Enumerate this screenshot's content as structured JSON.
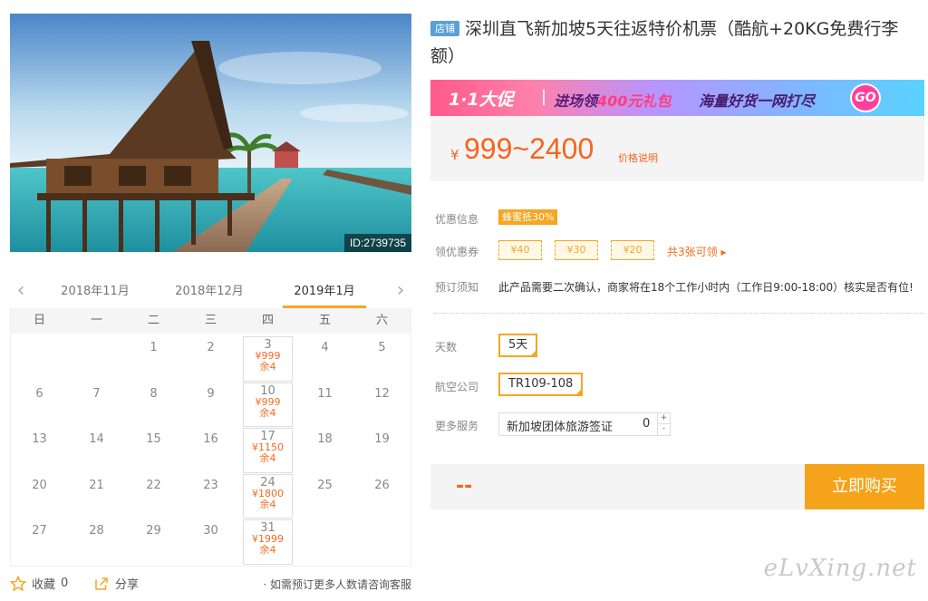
{
  "hero": {
    "id_label": "ID:2739735"
  },
  "calendar": {
    "prev_icon": "chevron-left-icon",
    "next_icon": "chevron-right-icon",
    "months": [
      "2018年11月",
      "2018年12月",
      "2019年1月"
    ],
    "active_month": "2019年1月",
    "weekdays": [
      "日",
      "一",
      "二",
      "三",
      "四",
      "五",
      "六"
    ],
    "days": [
      {
        "d": ""
      },
      {
        "d": ""
      },
      {
        "d": "1"
      },
      {
        "d": "2"
      },
      {
        "d": "3",
        "price": "¥999",
        "left": "余4"
      },
      {
        "d": "4"
      },
      {
        "d": "5"
      },
      {
        "d": "6"
      },
      {
        "d": "7"
      },
      {
        "d": "8"
      },
      {
        "d": "9"
      },
      {
        "d": "10",
        "price": "¥999",
        "left": "余4"
      },
      {
        "d": "11"
      },
      {
        "d": "12"
      },
      {
        "d": "13"
      },
      {
        "d": "14"
      },
      {
        "d": "15"
      },
      {
        "d": "16"
      },
      {
        "d": "17",
        "price": "¥1150",
        "left": "余4"
      },
      {
        "d": "18"
      },
      {
        "d": "19"
      },
      {
        "d": "20"
      },
      {
        "d": "21"
      },
      {
        "d": "22"
      },
      {
        "d": "23"
      },
      {
        "d": "24",
        "price": "¥1800",
        "left": "余4"
      },
      {
        "d": "25"
      },
      {
        "d": "26"
      },
      {
        "d": "27"
      },
      {
        "d": "28"
      },
      {
        "d": "29"
      },
      {
        "d": "30"
      },
      {
        "d": "31",
        "price": "¥1999",
        "left": "余4"
      },
      {
        "d": ""
      },
      {
        "d": ""
      }
    ]
  },
  "bottom": {
    "fav_label": "收藏",
    "fav_count": "0",
    "share_label": "分享",
    "consult": "· 如需预订更多人数请咨询客服"
  },
  "product": {
    "shop_tag": "店铺",
    "title": "深圳直飞新加坡5天往返特价机票（酷航+20KG免费行李额）"
  },
  "promo": {
    "part1": "1·1大促",
    "sep": "|",
    "part2a": "进场领",
    "part2b": "400元礼包",
    "part3": "海量好货一网打尽",
    "go": "GO"
  },
  "price": {
    "currency": "¥",
    "range": "999~2400",
    "note": "价格说明"
  },
  "info": {
    "discount_label": "优惠信息",
    "discount_badge": "蜂蜜抵30%",
    "coupon_label": "领优惠券",
    "coupons": [
      "¥40",
      "¥30",
      "¥20"
    ],
    "coupon_all": "共3张可领 ▸",
    "notice_label": "预订须知",
    "notice": "此产品需要二次确认，商家将在18个工作小时内（工作日9:00-18:00）核实是否有位!"
  },
  "options": {
    "days_label": "天数",
    "days_value": "5天",
    "airline_label": "航空公司",
    "airline_value": "TR109-108",
    "service_label": "更多服务",
    "service_name": "新加坡团体旅游签证",
    "service_qty": "0",
    "step_up": "+",
    "step_down": "-"
  },
  "buy": {
    "total": "--",
    "button": "立即购买"
  },
  "watermark": "eLvXing.net",
  "colors": {
    "accent": "#f5a623",
    "price": "#f5651e",
    "shop_tag": "#5a9fd6"
  }
}
